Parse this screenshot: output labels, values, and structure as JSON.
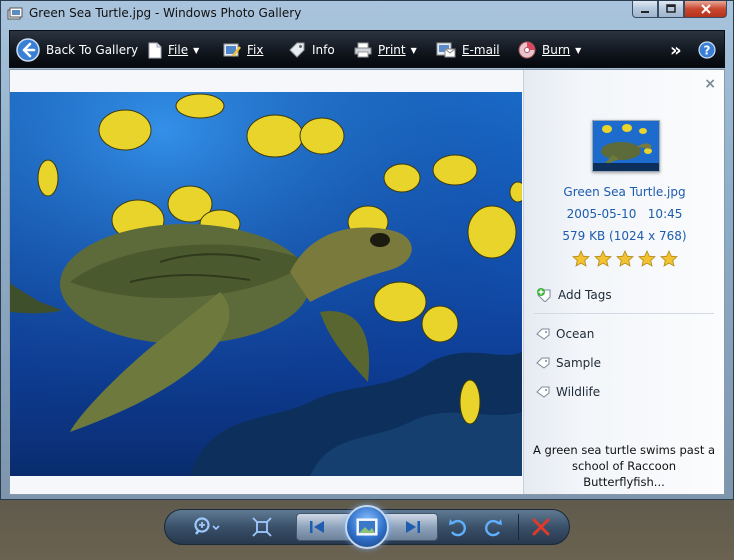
{
  "window": {
    "title": "Green Sea Turtle.jpg - Windows Photo Gallery"
  },
  "toolbar": {
    "back_label": "Back To Gallery",
    "file_label": "File",
    "fix_label": "Fix",
    "info_label": "Info",
    "print_label": "Print",
    "email_label": "E-mail",
    "burn_label": "Burn",
    "more_label": "»",
    "help_label": "?"
  },
  "info_panel": {
    "close_label": "×",
    "file_name": "Green Sea Turtle.jpg",
    "date": "2005-05-10",
    "time": "10:45",
    "size": "579 KB (1024 x 768)",
    "rating": 5,
    "add_tags_label": "Add Tags",
    "tags": [
      "Ocean",
      "Sample",
      "Wildlife"
    ],
    "caption_line1": "A green sea turtle swims past a",
    "caption_line2": "school of Raccoon Butterflyfish..."
  },
  "colors": {
    "toolbar_bg": "#121820",
    "link_blue": "#1d5cae",
    "star_gold": "#f2c230",
    "delete_red": "#e23a2a"
  },
  "icons": {
    "back": "back-arrow-icon",
    "file": "file-icon",
    "fix": "fix-icon",
    "info": "info-icon",
    "print": "printer-icon",
    "email": "email-icon",
    "burn": "burn-disc-icon",
    "help": "help-icon"
  }
}
